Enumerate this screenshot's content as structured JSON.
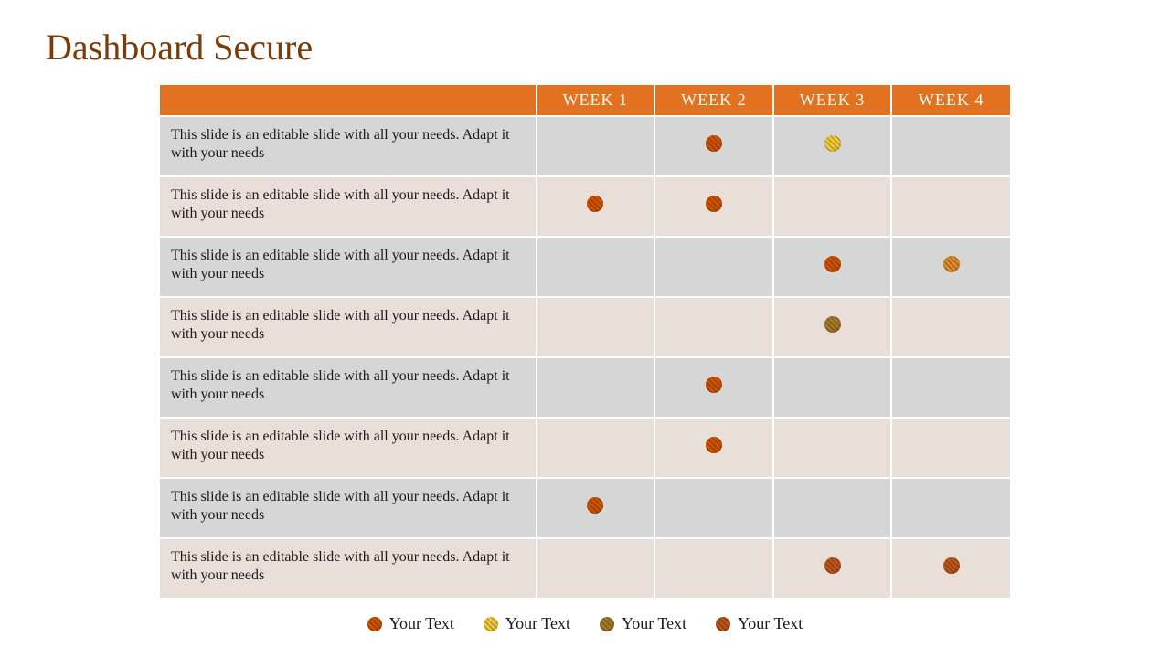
{
  "title": "Dashboard Secure",
  "columns": [
    "WEEK 1",
    "WEEK 2",
    "WEEK 3",
    "WEEK 4"
  ],
  "rowText": "This slide is an editable slide with all your needs. Adapt it with your needs",
  "rows": [
    {
      "dots": [
        null,
        "orange",
        "yellow",
        null
      ]
    },
    {
      "dots": [
        "orange",
        "orange",
        null,
        null
      ]
    },
    {
      "dots": [
        null,
        null,
        "orange",
        "lightorng"
      ]
    },
    {
      "dots": [
        null,
        null,
        "olive",
        null
      ]
    },
    {
      "dots": [
        null,
        "orange",
        null,
        null
      ]
    },
    {
      "dots": [
        null,
        "orange",
        null,
        null
      ]
    },
    {
      "dots": [
        "orange",
        null,
        null,
        null
      ]
    },
    {
      "dots": [
        null,
        null,
        "darkorange",
        "darkorange"
      ]
    }
  ],
  "legend": [
    {
      "label": "Your Text",
      "color": "orange"
    },
    {
      "label": "Your Text",
      "color": "yellow"
    },
    {
      "label": "Your Text",
      "color": "olive"
    },
    {
      "label": "Your Text",
      "color": "darkorange"
    }
  ]
}
